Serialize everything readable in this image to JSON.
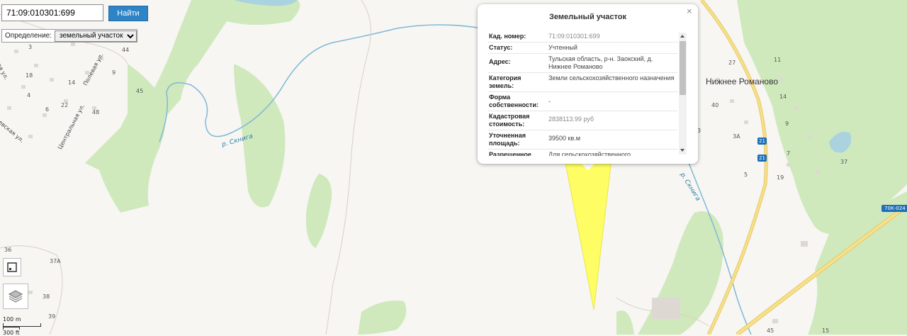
{
  "search": {
    "value": "71:09:010301:699",
    "button_label": "Найти"
  },
  "definition": {
    "label": "Определение:",
    "selected": "земельный участок"
  },
  "popup": {
    "title": "Земельный участок",
    "close": "×",
    "rows": [
      {
        "key": "Кад. номер:",
        "value": "71:09:010301:699"
      },
      {
        "key": "Статус:",
        "value": "Учтенный"
      },
      {
        "key": "Адрес:",
        "value": "Тульская область, р-н. Заокский, д. Нижнее Романово"
      },
      {
        "key": "Категория земель:",
        "value": "Земли сельскохозяйственного назначения"
      },
      {
        "key": "Форма собственности:",
        "value": "-"
      },
      {
        "key": "Кадастровая стоимость:",
        "value": "2838113.99 руб"
      },
      {
        "key": "Уточненная площадь:",
        "value": "39500 кв.м"
      },
      {
        "key": "Разрешенное",
        "value": "Для сельскохозяйственного"
      }
    ]
  },
  "map": {
    "place_name": "Нижнее Романово",
    "river_labels": [
      "р. Скнига",
      "р. Скнига"
    ],
    "streets": [
      "Полевая ул.",
      "Центральная ул.",
      "ая ул.",
      "евская ул."
    ],
    "road_code": "70К-024",
    "road_numbers": [
      "21",
      "21"
    ],
    "house_numbers_left": [
      "3",
      "44",
      "18",
      "14",
      "9",
      "45",
      "4",
      "22",
      "48",
      "6",
      "36",
      "37А",
      "38",
      "39"
    ],
    "house_numbers_right": [
      "27",
      "11",
      "40",
      "14",
      "9",
      "3",
      "3А",
      "5",
      "7",
      "19",
      "37",
      "45",
      "15"
    ]
  },
  "scale": {
    "metric": "100 m",
    "imperial": "300 ft"
  },
  "colors": {
    "parcel": "#ffff55",
    "forest": "#cfe9bd",
    "water": "#aad3df",
    "road_major": "#f6e08a",
    "accent": "#2f84c6"
  }
}
